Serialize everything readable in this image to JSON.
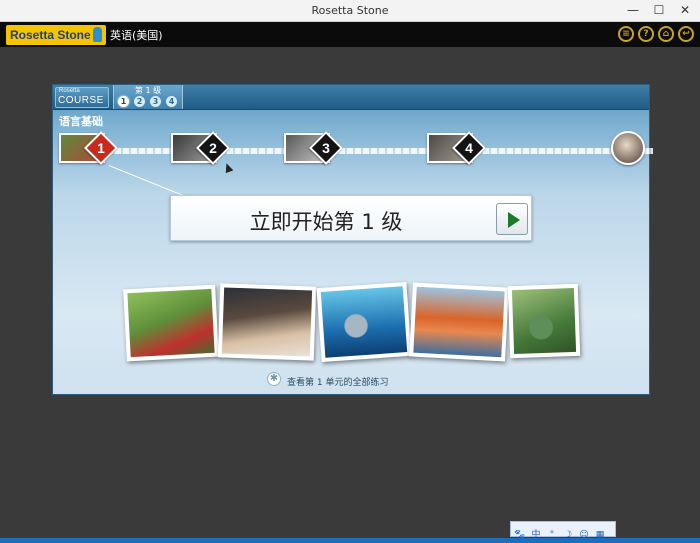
{
  "window": {
    "title": "Rosetta Stone",
    "min": "—",
    "max": "☐",
    "close": "✕"
  },
  "appbar": {
    "logo_text": "Rosetta Stone",
    "language": "英语(美国)",
    "icons": [
      "menu-icon",
      "help-icon",
      "home-icon",
      "back-icon"
    ],
    "icon_glyphs": [
      "≡",
      "?",
      "⌂",
      "↩"
    ]
  },
  "panel": {
    "badge_top": "Rosetta",
    "badge_main": "COURSE",
    "level_label": "第 1 级",
    "units": [
      "1",
      "2",
      "3",
      "4"
    ],
    "section_title": "语言基础",
    "lessons": [
      {
        "number": "1",
        "badge": "red",
        "photo_color": "#8b3b2e"
      },
      {
        "number": "2",
        "badge": "black",
        "photo_color": "#6c6c6c"
      },
      {
        "number": "3",
        "badge": "black",
        "photo_color": "#7e7e7e"
      },
      {
        "number": "4",
        "badge": "black",
        "photo_color": "#6f6a63"
      }
    ],
    "start_text": "立即开始第 1 级",
    "photos": [
      {
        "name": "girl-in-field",
        "color1": "#5f8f3a",
        "color2": "#c0302e"
      },
      {
        "name": "students-reading",
        "color1": "#30353d",
        "color2": "#c9a98d"
      },
      {
        "name": "underwater-fish",
        "color1": "#1c6fb0",
        "color2": "#66c4e6"
      },
      {
        "name": "friends-group",
        "color1": "#d9642a",
        "color2": "#3f6ea0"
      },
      {
        "name": "cup-outdoors",
        "color1": "#477a3a",
        "color2": "#9cbf7a"
      }
    ],
    "all_exercises": "查看第 1 单元的全部练习"
  },
  "ime": {
    "items": [
      "🐾",
      "中",
      "°",
      "☽",
      "☺",
      "▦"
    ]
  }
}
